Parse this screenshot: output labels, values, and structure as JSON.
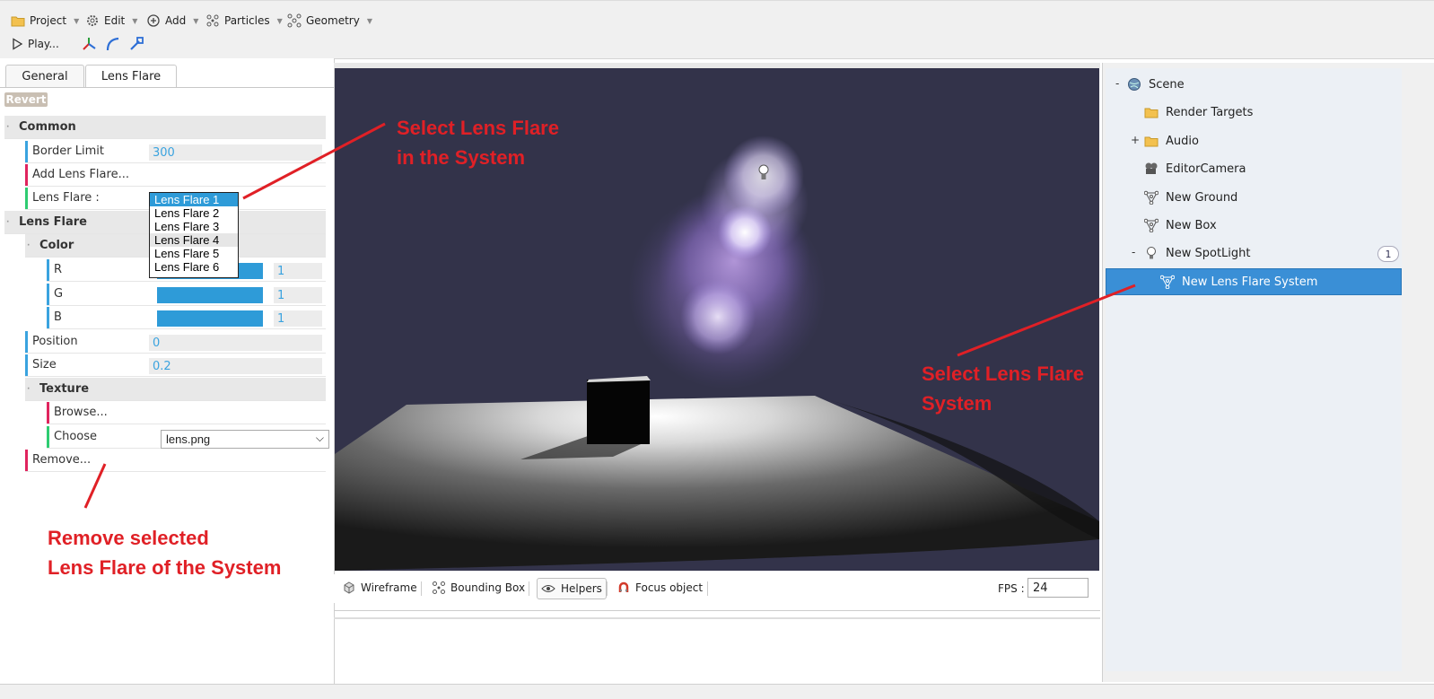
{
  "menubar": {
    "items": [
      {
        "label": "Project",
        "icon": "folder-icon"
      },
      {
        "label": "Edit",
        "icon": "gear-icon"
      },
      {
        "label": "Add",
        "icon": "plus-circle-icon"
      },
      {
        "label": "Particles",
        "icon": "particles-icon"
      },
      {
        "label": "Geometry",
        "icon": "geometry-icon"
      }
    ],
    "play_label": "Play..."
  },
  "left": {
    "tabs": [
      "General",
      "Lens Flare"
    ],
    "active_tab": "Lens Flare",
    "revert_label": "Revert",
    "common_title": "Common",
    "border_limit_label": "Border Limit",
    "border_limit_value": "300",
    "add_label": "Add Lens Flare...",
    "lens_flare_label": "Lens Flare :",
    "lens_flare_options": [
      "Lens Flare 1",
      "Lens Flare 2",
      "Lens Flare 3",
      "Lens Flare 4",
      "Lens Flare 5",
      "Lens Flare 6"
    ],
    "lens_flare_selected": "Lens Flare 1",
    "lens_flare_section": "Lens Flare",
    "color_section": "Color",
    "color": {
      "r_label": "R",
      "r_value": "1",
      "g_label": "G",
      "g_value": "1",
      "b_label": "B",
      "b_value": "1"
    },
    "position_label": "Position",
    "position_value": "0",
    "size_label": "Size",
    "size_value": "0.2",
    "texture_section": "Texture",
    "browse_label": "Browse...",
    "choose_label": "Choose",
    "choose_value": "lens.png",
    "remove_label": "Remove..."
  },
  "annotations": {
    "a1_line1": "Select Lens Flare",
    "a1_line2": "in the System",
    "a2_line1": "Select Lens Flare",
    "a2_line2": "System",
    "a3_line1": "Remove selected",
    "a3_line2": "Lens Flare of the System"
  },
  "viewport": {
    "buttons": [
      "Wireframe",
      "Bounding Box",
      "Helpers",
      "Focus object"
    ],
    "fps_label": "FPS :",
    "fps_value": "24"
  },
  "tree": {
    "scene": "Scene",
    "render_targets": "Render Targets",
    "audio": "Audio",
    "editor_camera": "EditorCamera",
    "new_ground": "New Ground",
    "new_box": "New Box",
    "new_spotlight": "New SpotLight",
    "spotlight_badge": "1",
    "new_lens_flare_system": "New Lens Flare System"
  },
  "colors": {
    "accent": "#3aa3df",
    "annotation": "#e02026",
    "tree_selection": "#3a8fd6"
  }
}
